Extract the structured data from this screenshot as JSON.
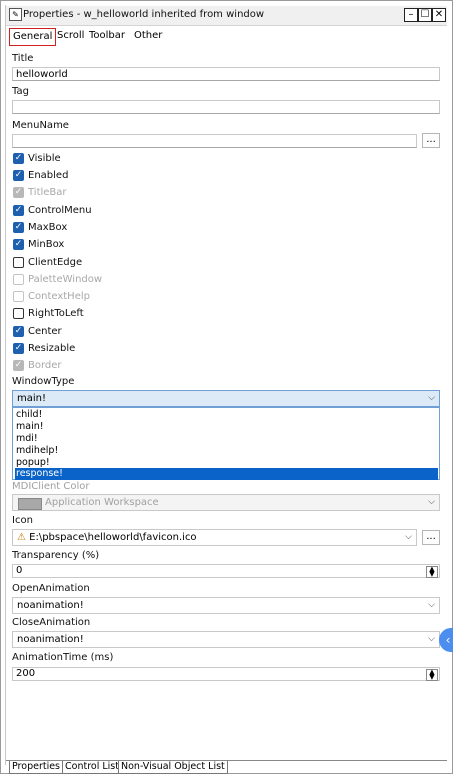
{
  "window": {
    "title": "Properties - w_helloworld  inherited  from  window",
    "minimize_label": "–",
    "restore_label": "☐",
    "close_label": "✕"
  },
  "tabs": [
    "General",
    "Scroll",
    "Toolbar",
    "Other"
  ],
  "fields": {
    "title_label": "Title",
    "title_value": "helloworld",
    "tag_label": "Tag",
    "tag_value": "",
    "menuname_label": "MenuName",
    "menuname_value": "",
    "browse_label": "..."
  },
  "checkboxes": [
    {
      "label": "Visible",
      "state": "checked"
    },
    {
      "label": "Enabled",
      "state": "checked"
    },
    {
      "label": "TitleBar",
      "state": "checked-disabled"
    },
    {
      "label": "ControlMenu",
      "state": "checked"
    },
    {
      "label": "MaxBox",
      "state": "checked"
    },
    {
      "label": "MinBox",
      "state": "checked"
    },
    {
      "label": "ClientEdge",
      "state": "unchecked"
    },
    {
      "label": "PaletteWindow",
      "state": "unchecked-disabled"
    },
    {
      "label": "ContextHelp",
      "state": "unchecked-disabled"
    },
    {
      "label": "RightToLeft",
      "state": "unchecked"
    },
    {
      "label": "Center",
      "state": "checked"
    },
    {
      "label": "Resizable",
      "state": "checked"
    },
    {
      "label": "Border",
      "state": "checked-disabled"
    }
  ],
  "windowtype": {
    "label": "WindowType",
    "value": "main!",
    "options": [
      "child!",
      "main!",
      "mdi!",
      "mdihelp!",
      "popup!",
      "response!"
    ],
    "highlighted": "response!"
  },
  "mdiclient": {
    "label": "MDIClient Color",
    "value": "Application Workspace",
    "swatch_color": "#a8a8a8"
  },
  "icon": {
    "label": "Icon",
    "value": "E:\\pbspace\\helloworld\\favicon.ico"
  },
  "transparency": {
    "label": "Transparency (%)",
    "value": "0"
  },
  "openanimation": {
    "label": "OpenAnimation",
    "value": "noanimation!"
  },
  "closeanimation": {
    "label": "CloseAnimation",
    "value": "noanimation!"
  },
  "animationtime": {
    "label": "AnimationTime (ms)",
    "value": "200"
  },
  "bottom_tabs": [
    "Properties",
    "Control List",
    "Non-Visual Object List"
  ],
  "colors": {
    "accent": "#1f5fb0",
    "selection": "#0a63c8",
    "tab_outline": "#d12020"
  }
}
